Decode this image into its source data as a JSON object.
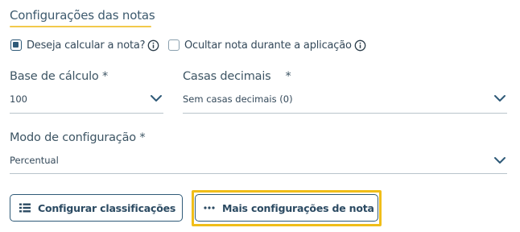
{
  "section": {
    "title": "Configurações das notas"
  },
  "checkboxes": [
    {
      "label": "Deseja calcular a nota?",
      "checked": true,
      "icon": "info-icon"
    },
    {
      "label": "Ocultar nota durante a aplicação",
      "checked": false,
      "icon": "info-icon"
    }
  ],
  "fields": {
    "base_calculo": {
      "label": "Base de cálculo *",
      "value": "100"
    },
    "casas_decimais": {
      "label": "Casas decimais",
      "required_mark": "*",
      "value": "Sem casas decimais (0)"
    },
    "modo_configuracao": {
      "label": "Modo de configuração *",
      "value": "Percentual"
    }
  },
  "buttons": {
    "configurar": {
      "label": "Configurar classificações",
      "icon": "list-icon"
    },
    "mais": {
      "label": "Mais configurações de nota",
      "icon": "ellipsis-icon"
    }
  },
  "colors": {
    "accent": "#f2c94c",
    "highlight": "#f0be19",
    "primary": "#2f5a78"
  }
}
